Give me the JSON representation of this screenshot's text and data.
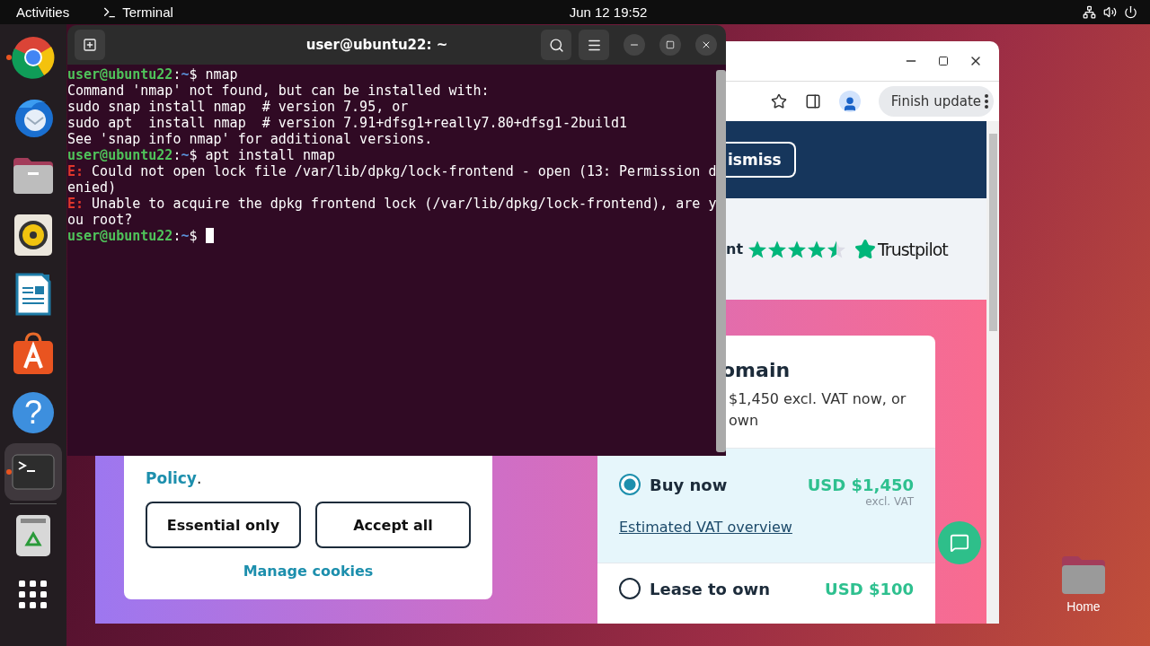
{
  "top_bar": {
    "activities": "Activities",
    "app_menu": "Terminal",
    "clock": "Jun 12  19:52"
  },
  "dock": {
    "items": [
      {
        "kind": "browser",
        "running": true,
        "selected": false
      },
      {
        "kind": "mail",
        "running": false,
        "selected": false
      },
      {
        "kind": "files",
        "running": false,
        "selected": false
      },
      {
        "kind": "music",
        "running": false,
        "selected": false
      },
      {
        "kind": "writer",
        "running": false,
        "selected": false
      },
      {
        "kind": "store",
        "running": false,
        "selected": false
      },
      {
        "kind": "help",
        "glyph": "?",
        "running": false,
        "selected": false
      },
      {
        "kind": "terminal",
        "running": true,
        "selected": true
      },
      {
        "kind": "trash",
        "running": false,
        "selected": false
      },
      {
        "kind": "apps",
        "running": false,
        "selected": false
      }
    ]
  },
  "browser": {
    "toolbar": {
      "update_button": "Finish update"
    },
    "banner": {
      "button": "ismiss"
    },
    "rating": {
      "text": "nt",
      "stars": 4.5,
      "logo": "Trustpilot"
    },
    "cookie_card": {
      "policy_link": "Policy",
      "policy_end": ".",
      "buttons": [
        "Essential only",
        "Accept all"
      ],
      "manage_link": "Manage cookies"
    },
    "domain_card": {
      "heading": "omain",
      "description": [
        "$1,450 excl. VAT now, or",
        "own"
      ],
      "options": [
        {
          "label": "Buy now",
          "price": "USD $1,450",
          "note": "excl. VAT",
          "link": "Estimated VAT overview",
          "selected": true
        },
        {
          "label": "Lease to own",
          "price": "USD $100",
          "selected": false
        }
      ]
    }
  },
  "terminal": {
    "title": "user@ubuntu22: ~",
    "lines": [
      {
        "kind": "prompt",
        "user": "user@ubuntu22",
        "sep": ":",
        "path": "~",
        "sigil": "$",
        "command": "nmap"
      },
      {
        "kind": "output",
        "text": "Command 'nmap' not found, but can be installed with:"
      },
      {
        "kind": "output",
        "text": "sudo snap install nmap  # version 7.95, or"
      },
      {
        "kind": "output",
        "text": "sudo apt  install nmap  # version 7.91+dfsg1+really7.80+dfsg1-2build1"
      },
      {
        "kind": "output",
        "text": "See 'snap info nmap' for additional versions."
      },
      {
        "kind": "prompt",
        "user": "user@ubuntu22",
        "sep": ":",
        "path": "~",
        "sigil": "$",
        "command": "apt install nmap"
      },
      {
        "kind": "error",
        "tag": "E:",
        "text": "Could not open lock file /var/lib/dpkg/lock-frontend - open (13: Permission d"
      },
      {
        "kind": "output",
        "text": "enied)"
      },
      {
        "kind": "error",
        "tag": "E:",
        "text": "Unable to acquire the dpkg frontend lock (/var/lib/dpkg/lock-frontend), are y"
      },
      {
        "kind": "output",
        "text": "ou root?"
      },
      {
        "kind": "prompt",
        "user": "user@ubuntu22",
        "sep": ":",
        "path": "~",
        "sigil": "$",
        "cursor": true
      }
    ]
  },
  "desktop": {
    "home_label": "Home"
  }
}
